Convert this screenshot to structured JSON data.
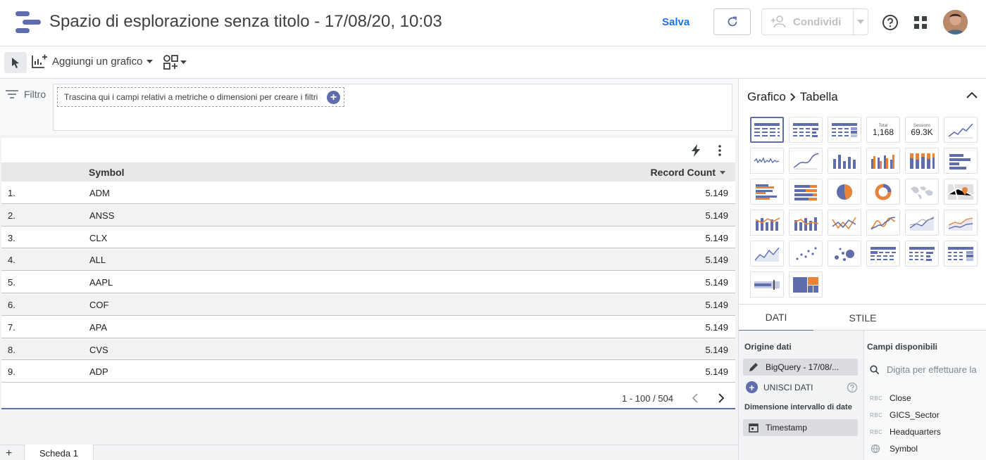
{
  "header": {
    "title": "Spazio di esplorazione senza titolo - 17/08/20, 10:03",
    "save_label": "Salva",
    "share_label": "Condividi"
  },
  "toolbar": {
    "add_chart_label": "Aggiungi un grafico"
  },
  "filter": {
    "label": "Filtro",
    "drop_hint": "Trascina qui i campi relativi a metriche o dimensioni per creare i filtri"
  },
  "table": {
    "columns": [
      "Symbol",
      "Record Count"
    ],
    "rows": [
      {
        "index": "1.",
        "symbol": "ADM",
        "count": "5.149"
      },
      {
        "index": "2.",
        "symbol": "ANSS",
        "count": "5.149"
      },
      {
        "index": "3.",
        "symbol": "CLX",
        "count": "5.149"
      },
      {
        "index": "4.",
        "symbol": "ALL",
        "count": "5.149"
      },
      {
        "index": "5.",
        "symbol": "AAPL",
        "count": "5.149"
      },
      {
        "index": "6.",
        "symbol": "COF",
        "count": "5.149"
      },
      {
        "index": "7.",
        "symbol": "APA",
        "count": "5.149"
      },
      {
        "index": "8.",
        "symbol": "CVS",
        "count": "5.149"
      },
      {
        "index": "9.",
        "symbol": "ADP",
        "count": "5.149"
      }
    ],
    "pagination": "1 - 100 / 504"
  },
  "pages": {
    "add_label": "+",
    "tab_label": "Scheda 1"
  },
  "panel": {
    "breadcrumb_root": "Grafico",
    "breadcrumb_current": "Tabella",
    "scorecard1_label": "Total",
    "scorecard1_value": "1,168",
    "scorecard2_label": "Sessions",
    "scorecard2_value": "69.3K",
    "tab_data": "DATI",
    "tab_style": "STILE",
    "datasource_label": "Origine dati",
    "datasource_name": "BigQuery - 17/08/...",
    "merge_label": "UNISCI DATI",
    "date_range_label": "Dimensione intervallo di date",
    "date_field": "Timestamp",
    "available_label": "Campi disponibili",
    "search_placeholder": "Digita per effettuare la",
    "available_fields": [
      {
        "type": "RBC",
        "name": "Close"
      },
      {
        "type": "RBC",
        "name": "GICS_Sector"
      },
      {
        "type": "RBC",
        "name": "Headquarters"
      },
      {
        "type": "globe",
        "name": "Symbol"
      }
    ]
  },
  "colors": {
    "accent": "#5f6dad",
    "orange": "#e8833a",
    "link_blue": "#1a73e8"
  }
}
